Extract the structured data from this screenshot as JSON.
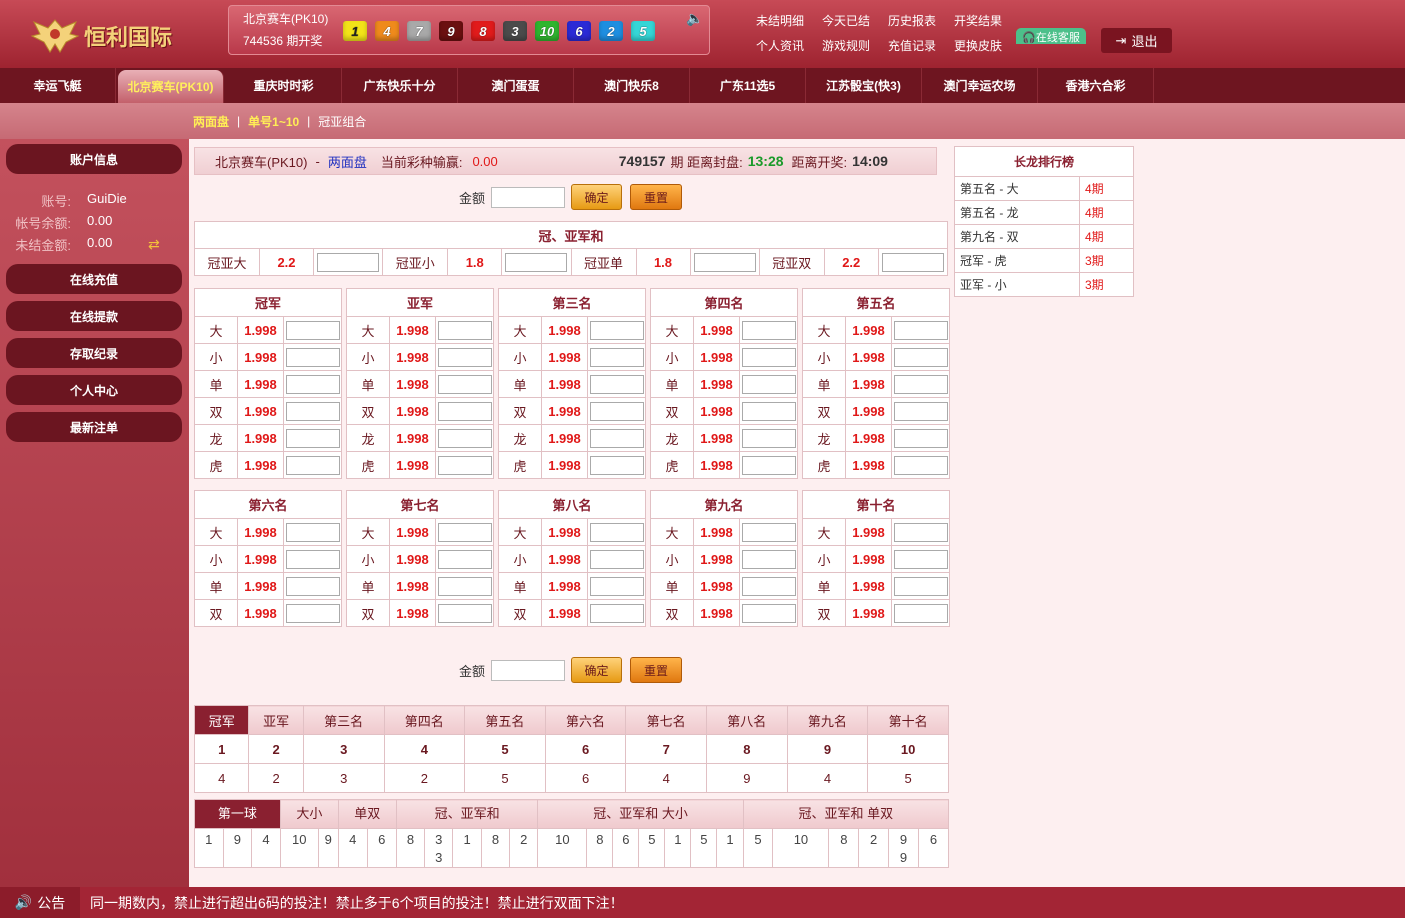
{
  "header": {
    "logo_text": "恒利国际",
    "lottery_name": "北京赛车(PK10)",
    "issue_text": "744536 期开奖",
    "balls": [
      {
        "n": "1",
        "bg": "#f2e318",
        "fg": "#222"
      },
      {
        "n": "4",
        "bg": "#ef8a1c",
        "fg": "#fff"
      },
      {
        "n": "7",
        "bg": "#a9a9a9",
        "fg": "#fff"
      },
      {
        "n": "9",
        "bg": "#6b1010",
        "fg": "#fff"
      },
      {
        "n": "8",
        "bg": "#e11b1b",
        "fg": "#fff"
      },
      {
        "n": "3",
        "bg": "#4b4b4b",
        "fg": "#fff"
      },
      {
        "n": "10",
        "bg": "#2fb52f",
        "fg": "#fff"
      },
      {
        "n": "6",
        "bg": "#2a2ad6",
        "fg": "#fff"
      },
      {
        "n": "2",
        "bg": "#1e8ee0",
        "fg": "#fff"
      },
      {
        "n": "5",
        "bg": "#35d6d6",
        "fg": "#fff"
      }
    ],
    "links": [
      "未结明细",
      "今天已结",
      "历史报表",
      "开奖结果",
      "个人资讯",
      "游戏规则",
      "充值记录",
      "更换皮肤"
    ],
    "service_label": "在线客服",
    "logout_label": "退出"
  },
  "nav": [
    "幸运飞艇",
    "北京赛车(PK10)",
    "重庆时时彩",
    "广东快乐十分",
    "澳门蛋蛋",
    "澳门快乐8",
    "广东11选5",
    "江苏骰宝(快3)",
    "澳门幸运农场",
    "香港六合彩"
  ],
  "nav_active": 1,
  "subnav": [
    "两面盘",
    "单号1~10",
    "冠亚组合"
  ],
  "sidebar": {
    "account_title": "账户信息",
    "account_label": "账号:",
    "account_value": "GuiDie",
    "balance_label": "帐号余额:",
    "balance_value": "0.00",
    "unsettled_label": "未结金额:",
    "unsettled_value": "0.00",
    "buttons": [
      "在线充值",
      "在线提款",
      "存取纪录",
      "个人中心",
      "最新注单"
    ]
  },
  "info": {
    "lottery": "北京赛车(PK10)",
    "sep": "-",
    "mode": "两面盘",
    "pl_label": "当前彩种输赢:",
    "pl_value": "0.00",
    "issue": "749157",
    "issue_suffix": "期 距离封盘:",
    "close_time": "13:28",
    "open_label": "距离开奖:",
    "open_time": "14:09"
  },
  "amount_label": "金额",
  "confirm_label": "确定",
  "reset_label": "重置",
  "sum_section": {
    "title": "冠、亚军和",
    "items": [
      {
        "label": "冠亚大",
        "odds": "2.2"
      },
      {
        "label": "冠亚小",
        "odds": "1.8"
      },
      {
        "label": "冠亚单",
        "odds": "1.8"
      },
      {
        "label": "冠亚双",
        "odds": "2.2"
      }
    ]
  },
  "positions_top": [
    "冠军",
    "亚军",
    "第三名",
    "第四名",
    "第五名"
  ],
  "positions_bottom": [
    "第六名",
    "第七名",
    "第八名",
    "第九名",
    "第十名"
  ],
  "options_top": [
    "大",
    "小",
    "单",
    "双",
    "龙",
    "虎"
  ],
  "options_bottom": [
    "大",
    "小",
    "单",
    "双"
  ],
  "odds_value": "1.998",
  "results": {
    "tabs": [
      "冠军",
      "亚军",
      "第三名",
      "第四名",
      "第五名",
      "第六名",
      "第七名",
      "第八名",
      "第九名",
      "第十名"
    ],
    "numbers": [
      "1",
      "2",
      "3",
      "4",
      "5",
      "6",
      "7",
      "8",
      "9",
      "10"
    ],
    "counts": [
      "4",
      "2",
      "3",
      "2",
      "5",
      "6",
      "4",
      "9",
      "4",
      "5"
    ]
  },
  "stats": {
    "tabs": [
      "第一球",
      "大小",
      "单双",
      "冠、亚军和",
      "冠、亚军和 大小",
      "冠、亚军和 单双"
    ],
    "cells": [
      "1",
      "9",
      "4",
      "10",
      "9",
      "4",
      "6",
      "8",
      "3\n3",
      "1",
      "8",
      "2",
      "10",
      "8",
      "6",
      "5",
      "1",
      "5",
      "1",
      "5",
      "10",
      "8",
      "2",
      "9\n9",
      "6"
    ]
  },
  "ranking": {
    "title": "长龙排行榜",
    "rows": [
      {
        "name": "第五名 - 大",
        "count": "4期"
      },
      {
        "name": "第五名 - 龙",
        "count": "4期"
      },
      {
        "name": "第九名 - 双",
        "count": "4期"
      },
      {
        "name": "冠军 - 虎",
        "count": "3期"
      },
      {
        "name": "亚军 - 小",
        "count": "3期"
      }
    ]
  },
  "footer": {
    "tag": "公告",
    "text": "同一期数内，禁止进行超出6码的投注！禁止多于6个项目的投注！禁止进行双面下注！"
  }
}
